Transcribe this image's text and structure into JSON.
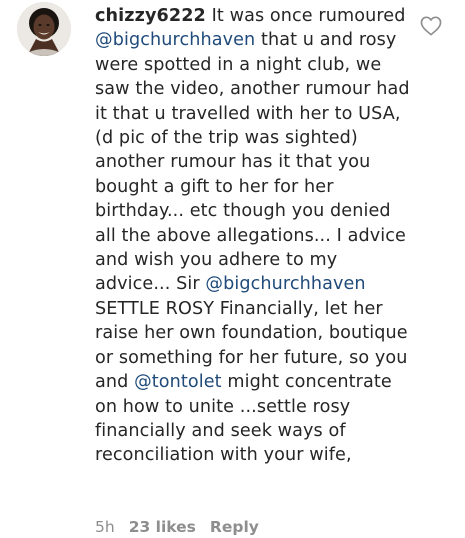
{
  "comment": {
    "username": "chizzy6222",
    "segments": [
      {
        "type": "text",
        "value": " It was once rumoured "
      },
      {
        "type": "mention",
        "value": "@bigchurchhaven"
      },
      {
        "type": "text",
        "value": " that u and rosy were spotted in a night club, we saw the video, another rumour had it that u travelled with her to USA, (d pic of the trip was sighted) another rumour has it that you bought a gift to her for her birthday... etc though you denied all the above allegations... I advice and wish you adhere to my advice... Sir "
      },
      {
        "type": "mention",
        "value": "@bigchurchhaven"
      },
      {
        "type": "text",
        "value": "  SETTLE ROSY Financially, let her raise her own foundation, boutique or something for her future, so you and "
      },
      {
        "type": "mention",
        "value": "@tontolet"
      },
      {
        "type": "text",
        "value": " might concentrate on how to unite ...settle rosy financially and seek ways of reconciliation with your wife,"
      }
    ],
    "time": "5h",
    "likes": "23 likes",
    "reply_label": "Reply",
    "like_icon": "heart-outline-icon",
    "mention_color": "#1f4a7a",
    "meta_color": "#8e8e8e"
  }
}
